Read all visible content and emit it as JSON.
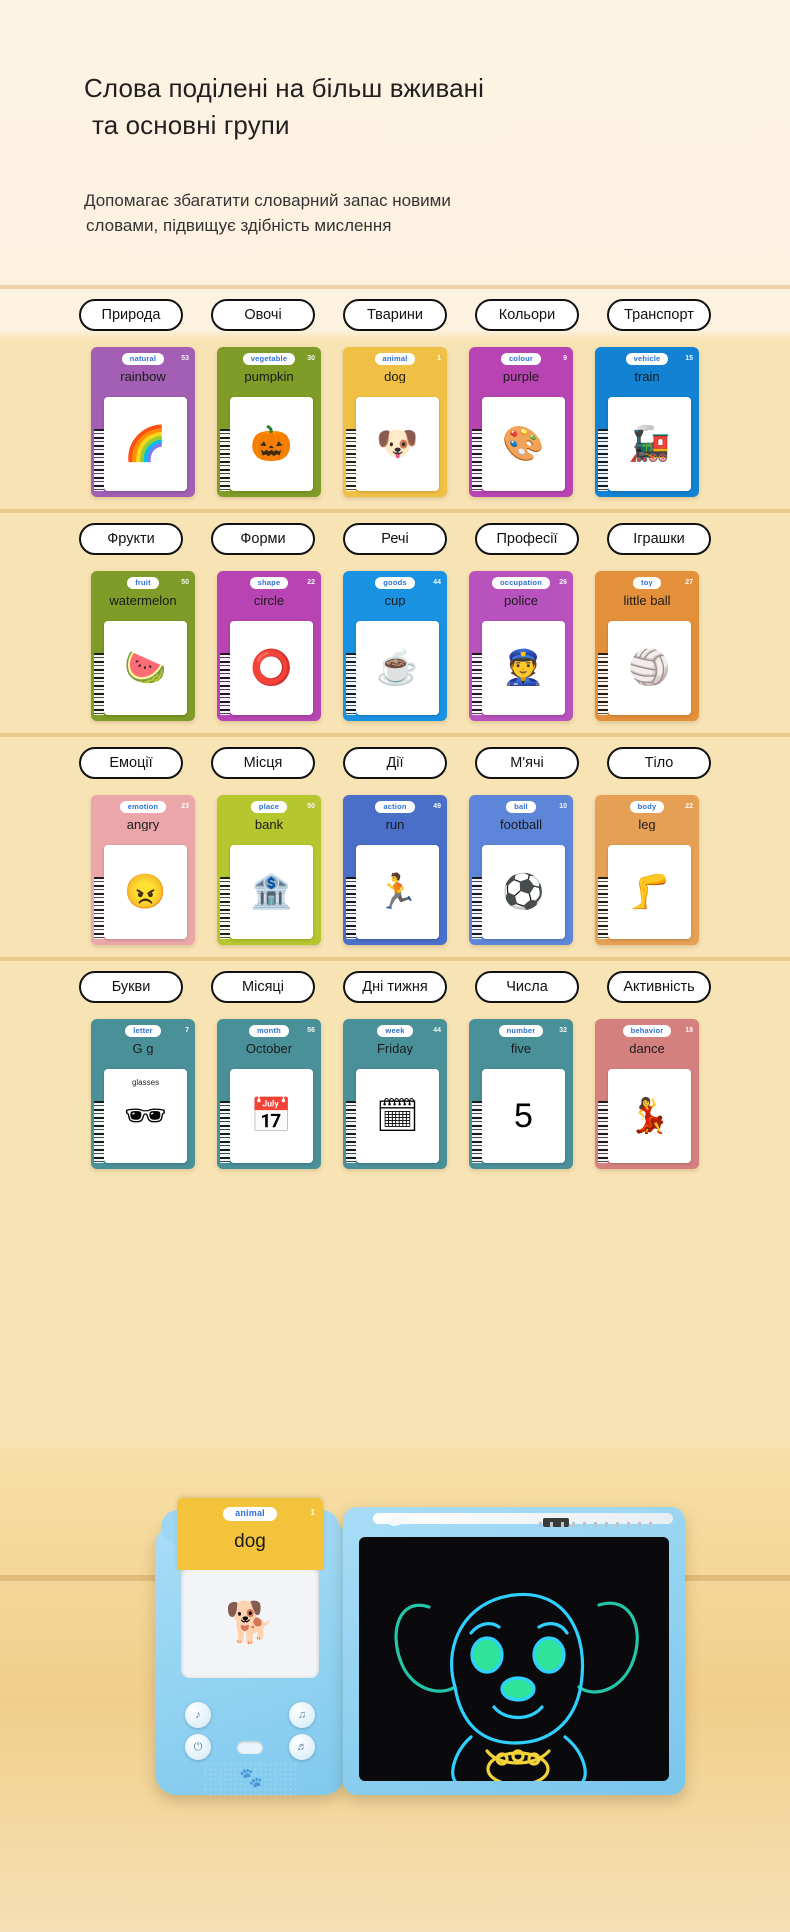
{
  "header": {
    "title_line1": "Слова поділені на більш вживані",
    "title_line2": "та основні групи",
    "subtitle_line1": "Допомагає збагатити словарний запас новими",
    "subtitle_line2": "словами, підвищує здібність мислення"
  },
  "rows": [
    {
      "chips": [
        "Природа",
        "Овочі",
        "Тварини",
        "Кольори",
        "Транспорт"
      ],
      "cards": [
        {
          "tag": "natural",
          "num": "53",
          "word": "rainbow",
          "color": "#a25fb4",
          "glyph": "🌈"
        },
        {
          "tag": "vegetable",
          "num": "30",
          "word": "pumpkin",
          "color": "#7f9b28",
          "glyph": "🎃"
        },
        {
          "tag": "animal",
          "num": "1",
          "word": "dog",
          "color": "#efc043",
          "glyph": "🐶"
        },
        {
          "tag": "colour",
          "num": "9",
          "word": "purple",
          "color": "#b744b2",
          "glyph": "🎨"
        },
        {
          "tag": "vehicle",
          "num": "15",
          "word": "train",
          "color": "#1382d2",
          "glyph": "🚂"
        }
      ]
    },
    {
      "chips": [
        "Фрукти",
        "Форми",
        "Речі",
        "Професії",
        "Іграшки"
      ],
      "cards": [
        {
          "tag": "fruit",
          "num": "50",
          "word": "watermelon",
          "color": "#7f9b28",
          "glyph": "🍉"
        },
        {
          "tag": "shape",
          "num": "22",
          "word": "circle",
          "color": "#b744b2",
          "glyph": "⭕"
        },
        {
          "tag": "goods",
          "num": "44",
          "word": "cup",
          "color": "#1a92e2",
          "glyph": "☕"
        },
        {
          "tag": "occupation",
          "num": "26",
          "word": "police",
          "color": "#b852bd",
          "glyph": "👮"
        },
        {
          "tag": "toy",
          "num": "27",
          "word": "little ball",
          "color": "#e4903a",
          "glyph": "🏐"
        }
      ]
    },
    {
      "chips": [
        "Емоції",
        "Місця",
        "Дії",
        "М'ячі",
        "Тіло"
      ],
      "cards": [
        {
          "tag": "emotion",
          "num": "23",
          "word": "angry",
          "color": "#eba6a9",
          "glyph": "😠"
        },
        {
          "tag": "place",
          "num": "50",
          "word": "bank",
          "color": "#b5c62e",
          "glyph": "🏦"
        },
        {
          "tag": "action",
          "num": "49",
          "word": "run",
          "color": "#4a6fc8",
          "glyph": "🏃"
        },
        {
          "tag": "ball",
          "num": "10",
          "word": "football",
          "color": "#5e86d8",
          "glyph": "⚽"
        },
        {
          "tag": "body",
          "num": "22",
          "word": "leg",
          "color": "#e6a055",
          "glyph": "🦵"
        }
      ]
    },
    {
      "chips": [
        "Букви",
        "Місяці",
        "Дні тижня",
        "Числа",
        "Активність"
      ],
      "cards": [
        {
          "tag": "letter",
          "num": "7",
          "word": "G g",
          "color": "#4a9099",
          "glyph": "🕶",
          "mini_label": "glasses"
        },
        {
          "tag": "month",
          "num": "56",
          "word": "October",
          "color": "#4a9099",
          "glyph": "📅"
        },
        {
          "tag": "week",
          "num": "44",
          "word": "Friday",
          "color": "#4a9099",
          "glyph": "🗓"
        },
        {
          "tag": "number",
          "num": "32",
          "word": "five",
          "color": "#4a9099",
          "glyph": "5"
        },
        {
          "tag": "behavior",
          "num": "18",
          "word": "dance",
          "color": "#d4807f",
          "glyph": "💃"
        }
      ]
    }
  ],
  "device": {
    "inserted_card": {
      "tag": "animal",
      "num": "1",
      "word": "dog",
      "glyph": "🐶"
    },
    "buttons": [
      "♪",
      "♫",
      "⏻",
      "♬"
    ],
    "slot_glyph": "🐕",
    "paw_glyph": "🐾"
  },
  "colors": {
    "page_bg": "#fdf3e3",
    "shelf_bg": "#f8e3b4",
    "chip_border": "#111111",
    "tag_text": "#2f6fd0"
  }
}
